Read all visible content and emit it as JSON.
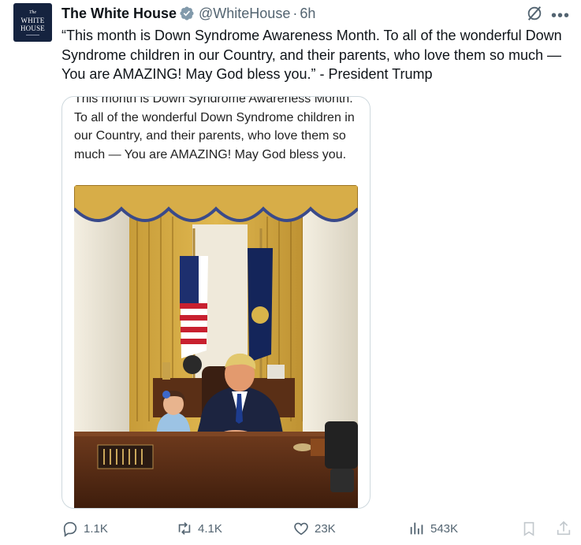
{
  "avatar": {
    "line1": "The",
    "line2": "WHITE",
    "line3": "HOUSE"
  },
  "header": {
    "name": "The White House",
    "handle": "@WhiteHouse",
    "separator": "·",
    "time": "6h",
    "more": "•••"
  },
  "tweet": {
    "text": "“This month is Down Syndrome Awareness Month. To all of the wonderful Down Syndrome children in our Country, and their parents, who love them so much — You are AMAZING! May God bless you.” - President Trump"
  },
  "media": {
    "text": "This month is Down Syndrome Awareness Month. To all of the wonderful Down Syndrome children in our Country, and their parents, who love them so much — You are AMAZING! May God bless you."
  },
  "actions": {
    "replies": "1.1K",
    "reposts": "4.1K",
    "likes": "23K",
    "views": "543K"
  },
  "colors": {
    "text": "#0f1419",
    "muted": "#536471",
    "verified": "#829aab",
    "border": "#cfd9de",
    "avatar_bg": "#15233f"
  }
}
